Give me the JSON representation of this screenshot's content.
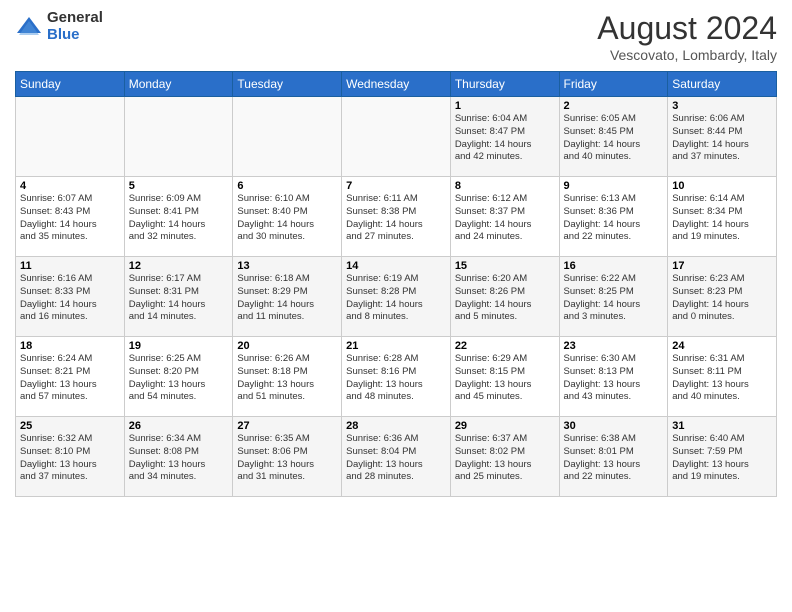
{
  "logo": {
    "general": "General",
    "blue": "Blue"
  },
  "title": "August 2024",
  "location": "Vescovato, Lombardy, Italy",
  "days_of_week": [
    "Sunday",
    "Monday",
    "Tuesday",
    "Wednesday",
    "Thursday",
    "Friday",
    "Saturday"
  ],
  "weeks": [
    [
      {
        "day": "",
        "info": ""
      },
      {
        "day": "",
        "info": ""
      },
      {
        "day": "",
        "info": ""
      },
      {
        "day": "",
        "info": ""
      },
      {
        "day": "1",
        "info": "Sunrise: 6:04 AM\nSunset: 8:47 PM\nDaylight: 14 hours\nand 42 minutes."
      },
      {
        "day": "2",
        "info": "Sunrise: 6:05 AM\nSunset: 8:45 PM\nDaylight: 14 hours\nand 40 minutes."
      },
      {
        "day": "3",
        "info": "Sunrise: 6:06 AM\nSunset: 8:44 PM\nDaylight: 14 hours\nand 37 minutes."
      }
    ],
    [
      {
        "day": "4",
        "info": "Sunrise: 6:07 AM\nSunset: 8:43 PM\nDaylight: 14 hours\nand 35 minutes."
      },
      {
        "day": "5",
        "info": "Sunrise: 6:09 AM\nSunset: 8:41 PM\nDaylight: 14 hours\nand 32 minutes."
      },
      {
        "day": "6",
        "info": "Sunrise: 6:10 AM\nSunset: 8:40 PM\nDaylight: 14 hours\nand 30 minutes."
      },
      {
        "day": "7",
        "info": "Sunrise: 6:11 AM\nSunset: 8:38 PM\nDaylight: 14 hours\nand 27 minutes."
      },
      {
        "day": "8",
        "info": "Sunrise: 6:12 AM\nSunset: 8:37 PM\nDaylight: 14 hours\nand 24 minutes."
      },
      {
        "day": "9",
        "info": "Sunrise: 6:13 AM\nSunset: 8:36 PM\nDaylight: 14 hours\nand 22 minutes."
      },
      {
        "day": "10",
        "info": "Sunrise: 6:14 AM\nSunset: 8:34 PM\nDaylight: 14 hours\nand 19 minutes."
      }
    ],
    [
      {
        "day": "11",
        "info": "Sunrise: 6:16 AM\nSunset: 8:33 PM\nDaylight: 14 hours\nand 16 minutes."
      },
      {
        "day": "12",
        "info": "Sunrise: 6:17 AM\nSunset: 8:31 PM\nDaylight: 14 hours\nand 14 minutes."
      },
      {
        "day": "13",
        "info": "Sunrise: 6:18 AM\nSunset: 8:29 PM\nDaylight: 14 hours\nand 11 minutes."
      },
      {
        "day": "14",
        "info": "Sunrise: 6:19 AM\nSunset: 8:28 PM\nDaylight: 14 hours\nand 8 minutes."
      },
      {
        "day": "15",
        "info": "Sunrise: 6:20 AM\nSunset: 8:26 PM\nDaylight: 14 hours\nand 5 minutes."
      },
      {
        "day": "16",
        "info": "Sunrise: 6:22 AM\nSunset: 8:25 PM\nDaylight: 14 hours\nand 3 minutes."
      },
      {
        "day": "17",
        "info": "Sunrise: 6:23 AM\nSunset: 8:23 PM\nDaylight: 14 hours\nand 0 minutes."
      }
    ],
    [
      {
        "day": "18",
        "info": "Sunrise: 6:24 AM\nSunset: 8:21 PM\nDaylight: 13 hours\nand 57 minutes."
      },
      {
        "day": "19",
        "info": "Sunrise: 6:25 AM\nSunset: 8:20 PM\nDaylight: 13 hours\nand 54 minutes."
      },
      {
        "day": "20",
        "info": "Sunrise: 6:26 AM\nSunset: 8:18 PM\nDaylight: 13 hours\nand 51 minutes."
      },
      {
        "day": "21",
        "info": "Sunrise: 6:28 AM\nSunset: 8:16 PM\nDaylight: 13 hours\nand 48 minutes."
      },
      {
        "day": "22",
        "info": "Sunrise: 6:29 AM\nSunset: 8:15 PM\nDaylight: 13 hours\nand 45 minutes."
      },
      {
        "day": "23",
        "info": "Sunrise: 6:30 AM\nSunset: 8:13 PM\nDaylight: 13 hours\nand 43 minutes."
      },
      {
        "day": "24",
        "info": "Sunrise: 6:31 AM\nSunset: 8:11 PM\nDaylight: 13 hours\nand 40 minutes."
      }
    ],
    [
      {
        "day": "25",
        "info": "Sunrise: 6:32 AM\nSunset: 8:10 PM\nDaylight: 13 hours\nand 37 minutes."
      },
      {
        "day": "26",
        "info": "Sunrise: 6:34 AM\nSunset: 8:08 PM\nDaylight: 13 hours\nand 34 minutes."
      },
      {
        "day": "27",
        "info": "Sunrise: 6:35 AM\nSunset: 8:06 PM\nDaylight: 13 hours\nand 31 minutes."
      },
      {
        "day": "28",
        "info": "Sunrise: 6:36 AM\nSunset: 8:04 PM\nDaylight: 13 hours\nand 28 minutes."
      },
      {
        "day": "29",
        "info": "Sunrise: 6:37 AM\nSunset: 8:02 PM\nDaylight: 13 hours\nand 25 minutes."
      },
      {
        "day": "30",
        "info": "Sunrise: 6:38 AM\nSunset: 8:01 PM\nDaylight: 13 hours\nand 22 minutes."
      },
      {
        "day": "31",
        "info": "Sunrise: 6:40 AM\nSunset: 7:59 PM\nDaylight: 13 hours\nand 19 minutes."
      }
    ]
  ]
}
